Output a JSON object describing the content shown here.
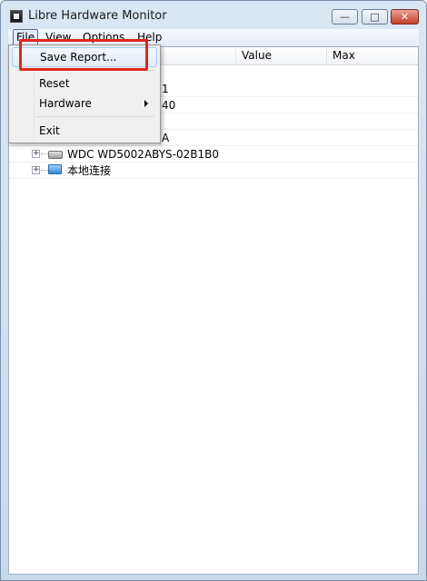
{
  "window": {
    "title": "Libre Hardware Monitor",
    "buttons": {
      "minimize": "—",
      "maximize": "□",
      "close": "✕"
    }
  },
  "menubar": {
    "file": "File",
    "view": "View",
    "options": "Options",
    "help": "Help"
  },
  "columns": {
    "sensor": "",
    "value": "Value",
    "max": "Max"
  },
  "tree": {
    "partial_rows": [
      "1",
      "40",
      "A"
    ],
    "nodes": [
      {
        "label": "WDC WD5002ABYS-02B1B0",
        "icon": "hard-disk-icon"
      },
      {
        "label": "本地连接",
        "icon": "network-adapter-icon"
      }
    ]
  },
  "file_menu": {
    "save_report": "Save Report...",
    "reset": "Reset",
    "hardware": "Hardware",
    "exit": "Exit"
  },
  "colors": {
    "highlight": "#e0261f"
  }
}
